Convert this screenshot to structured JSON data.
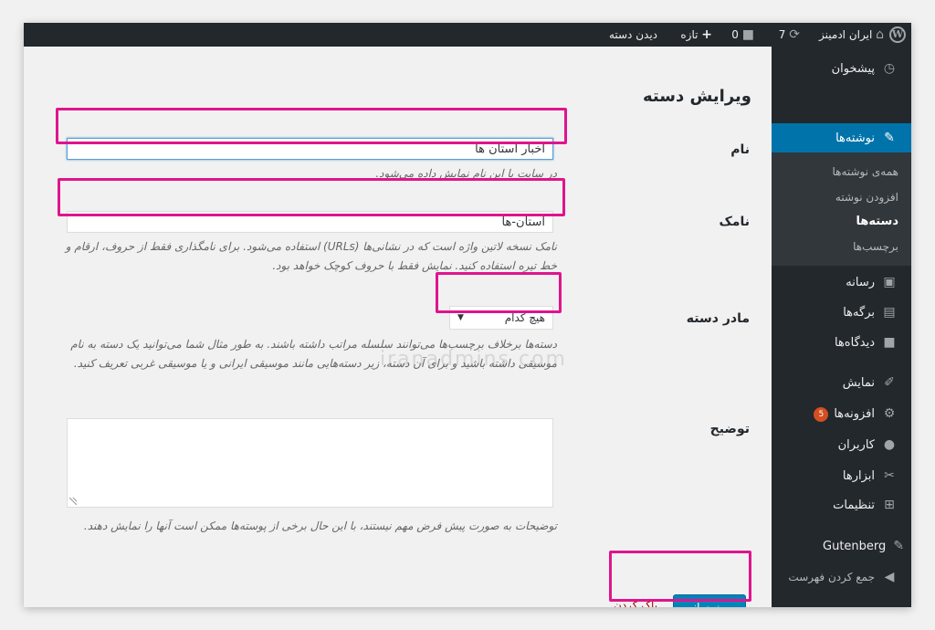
{
  "admin_bar": {
    "site_name": "ایران ادمینز",
    "updates_count": "7",
    "comments_count": "0",
    "new_label": "تازه",
    "view_category_label": "دیدن دسته"
  },
  "sidebar": {
    "dashboard": "پیشخوان",
    "posts": "نوشته‌ها",
    "posts_submenu": [
      "همه‌ی نوشته‌ها",
      "افزودن نوشته",
      "دسته‌ها",
      "برچسب‌ها"
    ],
    "media": "رسانه",
    "pages": "برگه‌ها",
    "comments": "دیدگاه‌ها",
    "appearance": "نمایش",
    "plugins": "افزونه‌ها",
    "plugins_badge": "5",
    "users": "کاربران",
    "tools": "ابزارها",
    "settings": "تنظیمات",
    "gutenberg": "Gutenberg",
    "collapse": "جمع کردن فهرست"
  },
  "form": {
    "title": "ویرایش دسته",
    "name_label": "نام",
    "name_value": "اخبار استان ها",
    "name_desc": "در سایت با این نام نمایش داده می‌شود.",
    "slug_label": "نامک",
    "slug_value": "استان-ها",
    "slug_desc": "نامک نسخه لاتین واژه است که در نشانی‌ها (URLs) استفاده می‌شود. برای نامگذاری فقط از حروف، ارقام و خط تیره استفاده کنید. نمایش فقط با حروف کوچک خواهد بود.",
    "parent_label": "مادر دسته",
    "parent_value": "هیچ کدام",
    "parent_desc": "دسته‌ها برخلاف برچسب‌ها می‌توانند سلسله مراتب داشته باشند. به طور مثال شما می‌توانید یک دسته به نام موسیقی داشته باشید و برای آن دسته، زیر دسته‌هایی مانند موسیقی ایرانی و یا موسیقی غربی تعریف کنید.",
    "desc_label": "توضیح",
    "desc_value": "",
    "desc_desc": "توضیحات به صورت پیش فرض مهم نیستند، با این حال برخی از پوسته‌ها ممکن است آنها را نمایش دهند.",
    "update_button": "بروزرسانی",
    "delete_link": "پاک کردن"
  },
  "watermark": "iranadmins.com",
  "colors": {
    "highlight": "#e0148d",
    "primary": "#0085ba",
    "sidebar": "#23282d",
    "active": "#0073aa"
  }
}
